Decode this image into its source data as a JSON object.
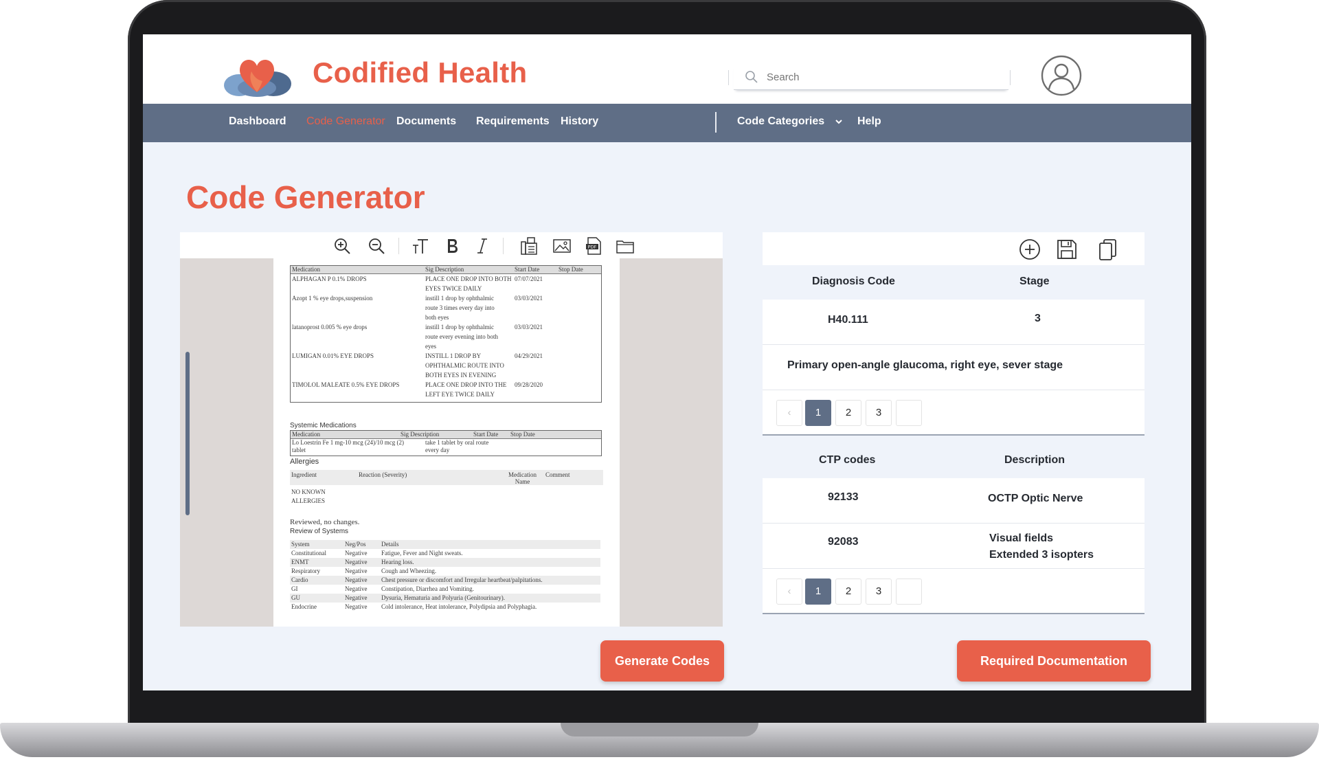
{
  "app": {
    "brand": "Codified Health"
  },
  "colors": {
    "accent": "#e8604a",
    "nav_bg": "#5f6e86",
    "page_bg": "#eff3fa"
  },
  "search": {
    "placeholder": "Search"
  },
  "nav": {
    "items": [
      {
        "label": "Dashboard"
      },
      {
        "label": "Code Generator",
        "active": true
      },
      {
        "label": "Documents"
      },
      {
        "label": "Requirements"
      },
      {
        "label": "History"
      },
      {
        "label": "Code Categories",
        "dropdown": true
      },
      {
        "label": "Help"
      }
    ]
  },
  "page": {
    "title": "Code Generator"
  },
  "doc_toolbar": {
    "icons": [
      "zoom-in-icon",
      "zoom-out-icon",
      "text-size-icon",
      "bold-icon",
      "italic-icon",
      "fax-icon",
      "image-icon",
      "pdf-icon",
      "folder-icon"
    ]
  },
  "document": {
    "med_headers": [
      "Medication",
      "Sig Description",
      "Start Date",
      "Stop Date"
    ],
    "med_rows": [
      {
        "med": "ALPHAGAN P 0.1% DROPS",
        "sig": [
          "PLACE ONE DROP INTO BOTH",
          "EYES TWICE DAILY"
        ],
        "start": "07/07/2021"
      },
      {
        "med": "Azopt 1 % eye drops,suspension",
        "sig": [
          "instill 1 drop by ophthalmic",
          "route 3 times every day into",
          "both eyes"
        ],
        "start": "03/03/2021"
      },
      {
        "med": "latanoprost 0.005 % eye drops",
        "sig": [
          "instill 1 drop by ophthalmic",
          "route every evening into both",
          "eyes"
        ],
        "start": "03/03/2021"
      },
      {
        "med": "LUMIGAN 0.01% EYE DROPS",
        "sig": [
          "INSTILL 1 DROP BY",
          "OPHTHALMIC ROUTE INTO",
          "BOTH EYES IN EVENING"
        ],
        "start": "04/29/2021"
      },
      {
        "med": "TIMOLOL MALEATE 0.5% EYE DROPS",
        "sig": [
          "PLACE ONE DROP INTO THE",
          "LEFT EYE TWICE DAILY"
        ],
        "start": "09/28/2020"
      }
    ],
    "systemic_title": "Systemic Medications",
    "sys_row": {
      "med": [
        "Lo Loestrin Fe 1 mg-10 mcg (24)/10 mcg (2)",
        "tablet"
      ],
      "sig": [
        "take 1 tablet by oral route",
        "every day"
      ]
    },
    "allergies_title": "Allergies",
    "allergy_headers": [
      "Ingredient",
      "Reaction (Severity)",
      "Medication",
      "Name",
      "Comment"
    ],
    "allergy_value": [
      "NO KNOWN",
      "ALLERGIES"
    ],
    "reviewed": "Reviewed, no changes.",
    "ros_title": "Review of Systems",
    "ros_headers": [
      "System",
      "Neg/Pos",
      "Details"
    ],
    "ros_rows": [
      [
        "Constitutional",
        "Negative",
        "Fatigue, Fever and Night sweats."
      ],
      [
        "ENMT",
        "Negative",
        "Hearing loss."
      ],
      [
        "Respiratory",
        "Negative",
        "Cough and Wheezing."
      ],
      [
        "Cardio",
        "Negative",
        "Chest pressure or discomfort and Irregular heartbeat/palpitations."
      ],
      [
        "GI",
        "Negative",
        "Constipation, Diarrhea and Vomiting."
      ],
      [
        "GU",
        "Negative",
        "Dysuria, Hematuria and Polyuria (Genitourinary)."
      ],
      [
        "Endocrine",
        "Negative",
        "Cold intolerance, Heat intolerance, Polydipsia and Polyphagia."
      ]
    ]
  },
  "code_toolbar": {
    "icons": [
      "add-circle-icon",
      "save-icon",
      "copy-icon"
    ]
  },
  "diagnosis": {
    "headers": {
      "code": "Diagnosis Code",
      "stage": "Stage"
    },
    "row": {
      "code": "H40.111",
      "stage": "3"
    },
    "description": "Primary open-angle glaucoma, right eye, sever stage",
    "pager": {
      "prev": "‹",
      "pages": [
        "1",
        "2",
        "3"
      ],
      "active": "1"
    }
  },
  "ctp": {
    "headers": {
      "code": "CTP codes",
      "desc": "Description"
    },
    "rows": [
      {
        "code": "92133",
        "desc": [
          "OCTP Optic Nerve"
        ]
      },
      {
        "code": "92083",
        "desc": [
          "Visual fields",
          "Extended 3 isopters"
        ]
      }
    ],
    "pager": {
      "prev": "‹",
      "pages": [
        "1",
        "2",
        "3"
      ],
      "active": "1"
    }
  },
  "buttons": {
    "generate": "Generate Codes",
    "required_docs": "Required Documentation"
  }
}
